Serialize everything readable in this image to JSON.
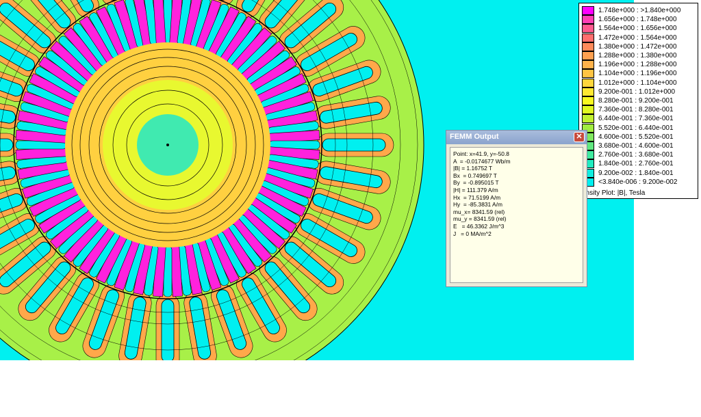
{
  "window": {
    "dialog_title": "FEMM Output",
    "close_glyph": "✕"
  },
  "output_lines": [
    "Point: x=41.9, y=-50.8",
    "A  = -0.0174677 Wb/m",
    "|B| = 1.16752 T",
    "Bx  = 0.749697 T",
    "By  = -0.895015 T",
    "|H| = 111.379 A/m",
    "Hx  = 71.5199 A/m",
    "Hy  = -85.3831 A/m",
    "mu_x= 8341.59 (rel)",
    "mu_y = 8341.59 (rel)",
    "E   = 46.3362 J/m^3",
    "J   = 0 MA/m^2"
  ],
  "legend": {
    "caption": "ensity Plot: |B|, Tesla",
    "rows": [
      {
        "label": "1.748e+000 : >1.840e+000",
        "color": "#ff00ff"
      },
      {
        "label": "1.656e+000 : 1.748e+000",
        "color": "#ff3fb6"
      },
      {
        "label": "1.564e+000 : 1.656e+000",
        "color": "#ff5a8f"
      },
      {
        "label": "1.472e+000 : 1.564e+000",
        "color": "#ff6e6e"
      },
      {
        "label": "1.380e+000 : 1.472e+000",
        "color": "#ff8a5a"
      },
      {
        "label": "1.288e+000 : 1.380e+000",
        "color": "#ffa050"
      },
      {
        "label": "1.196e+000 : 1.288e+000",
        "color": "#ffb24a"
      },
      {
        "label": "1.104e+000 : 1.196e+000",
        "color": "#ffc444"
      },
      {
        "label": "1.012e+000 : 1.104e+000",
        "color": "#ffd63c"
      },
      {
        "label": "9.200e-001 : 1.012e+000",
        "color": "#ffe832"
      },
      {
        "label": "8.280e-001 : 9.200e-001",
        "color": "#f8f820"
      },
      {
        "label": "7.360e-001 : 8.280e-001",
        "color": "#e0f820"
      },
      {
        "label": "6.440e-001 : 7.360e-001",
        "color": "#c0f030"
      },
      {
        "label": "5.520e-001 : 6.440e-001",
        "color": "#a0ec40"
      },
      {
        "label": "4.600e-001 : 5.520e-001",
        "color": "#80e860"
      },
      {
        "label": "3.680e-001 : 4.600e-001",
        "color": "#60e880"
      },
      {
        "label": "2.760e-001 : 3.680e-001",
        "color": "#40eaa0"
      },
      {
        "label": "1.840e-001 : 2.760e-001",
        "color": "#20ecc0"
      },
      {
        "label": "9.200e-002 : 1.840e-001",
        "color": "#10eee0"
      },
      {
        "label": "<3.840e-006 : 9.200e-002",
        "color": "#00f0f0"
      }
    ]
  },
  "plot": {
    "center_point": {
      "x": 41.9,
      "y": -50.8
    },
    "stator_slots": 36,
    "rotor_slots": 48
  }
}
